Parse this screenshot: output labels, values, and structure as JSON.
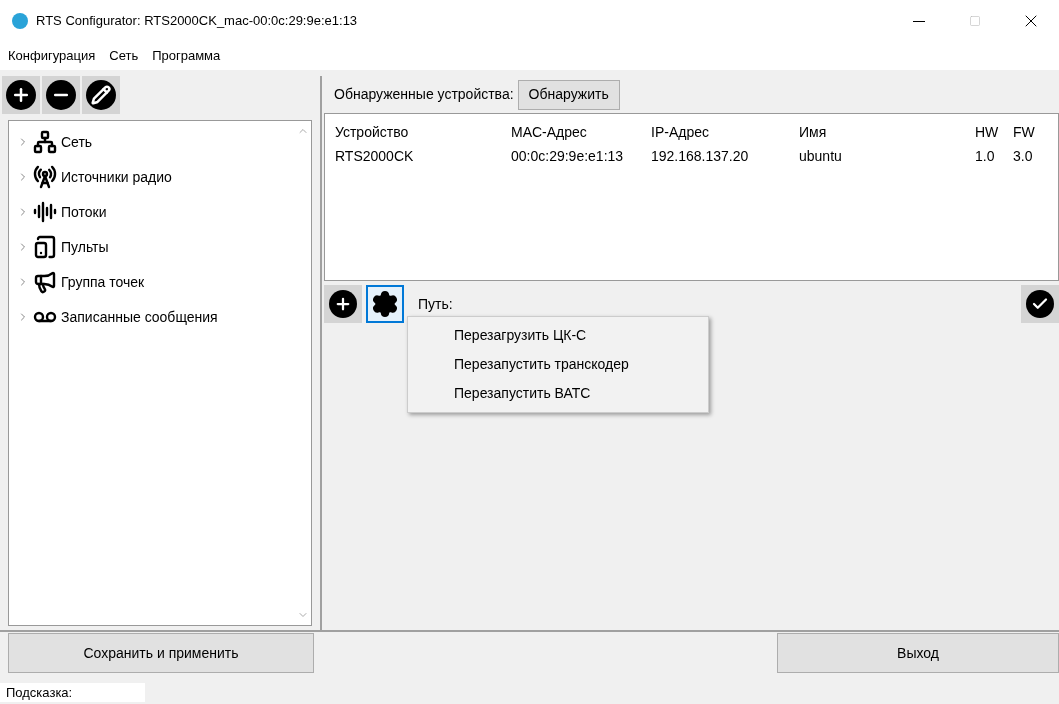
{
  "window": {
    "title": "RTS Configurator: RTS2000CK_mac-00:0c:29:9e:e1:13"
  },
  "menu": [
    "Конфигурация",
    "Сеть",
    "Программа"
  ],
  "tree": {
    "items": [
      {
        "label": "Сеть",
        "expanded": false
      },
      {
        "label": "Источники радио",
        "expanded": false
      },
      {
        "label": "Потоки",
        "expanded": false
      },
      {
        "label": "Пульты",
        "expanded": false
      },
      {
        "label": "Группа точек",
        "expanded": false
      },
      {
        "label": "Записанные сообщения",
        "expanded": false
      }
    ]
  },
  "devices": {
    "label": "Обнаруженные устройства:",
    "discover_button": "Обнаружить",
    "columns": [
      "Устройство",
      "MAC-Адрес",
      "IP-Адрес",
      "Имя",
      "HW",
      "FW"
    ],
    "rows": [
      {
        "cells": [
          "RTS2000CK",
          "00:0c:29:9e:e1:13",
          "192.168.137.20",
          "ubuntu",
          "1.0",
          "3.0"
        ],
        "selected": false
      }
    ]
  },
  "path": {
    "label": "Путь:"
  },
  "context_menu": [
    "Перезагрузить ЦК-С",
    "Перезапустить транскодер",
    "Перезапустить ВАТС"
  ],
  "buttons": {
    "save": "Сохранить и применить",
    "exit": "Выход"
  },
  "status_bar": {
    "label": "Подсказка:"
  }
}
